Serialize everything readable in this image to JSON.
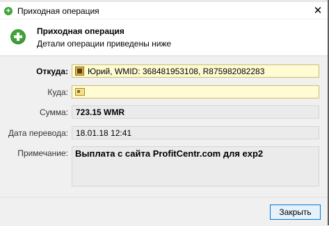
{
  "window": {
    "title": "Приходная операция",
    "close_glyph": "✕"
  },
  "header": {
    "title": "Приходная операция",
    "subtitle": "Детали операции приведены ниже",
    "icon": "green-plus-icon"
  },
  "form": {
    "from_label": "Откуда:",
    "from_value": "Юрий, WMID: 368481953108, R875982082283",
    "to_label": "Куда:",
    "to_value": "",
    "amount_label": "Сумма:",
    "amount_value": "723.15 WMR",
    "date_label": "Дата перевода:",
    "date_value": "18.01.18 12:41",
    "note_label": "Примечание:",
    "note_value": "Выплата с сайта ProfitCentr.com для exp2"
  },
  "footer": {
    "close_label": "Закрыть"
  },
  "colors": {
    "accent_green": "#3fa43a",
    "button_border": "#0078d7",
    "highlight_field": "#fffbd3"
  }
}
